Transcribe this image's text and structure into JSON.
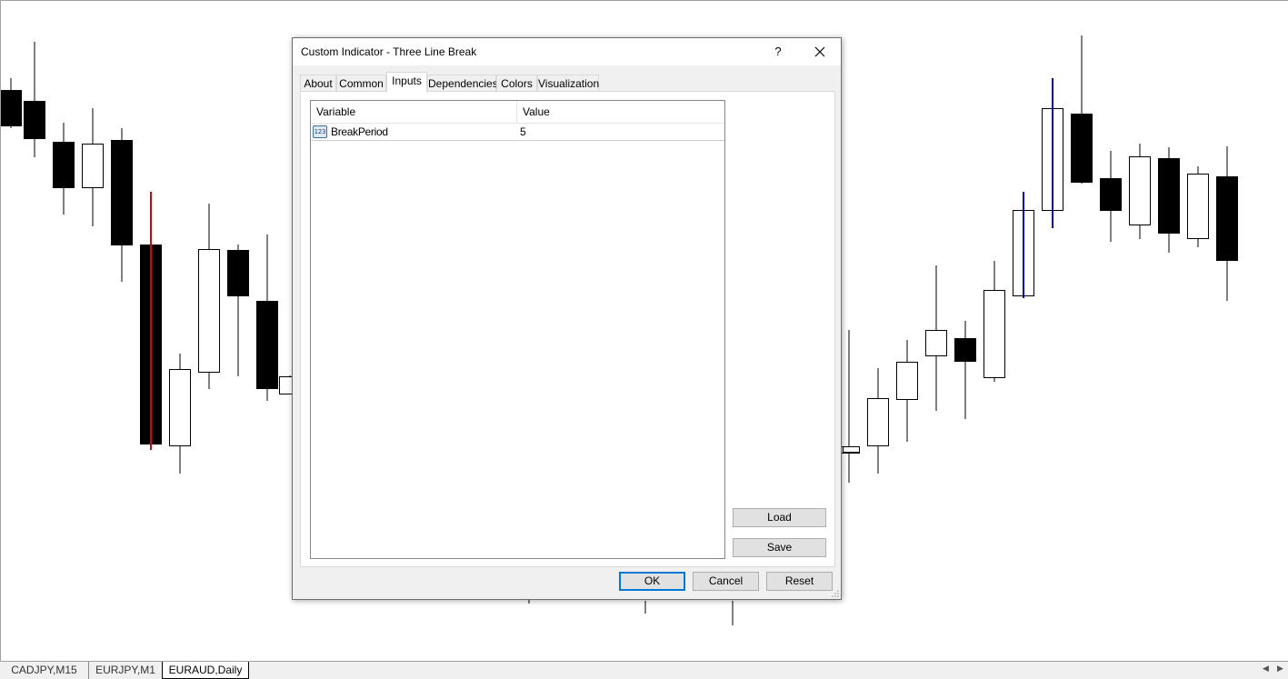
{
  "dialog": {
    "title": "Custom Indicator - Three Line Break",
    "help_label": "?",
    "tabs": [
      {
        "label": "About"
      },
      {
        "label": "Common"
      },
      {
        "label": "Inputs"
      },
      {
        "label": "Dependencies"
      },
      {
        "label": "Colors"
      },
      {
        "label": "Visualization"
      }
    ],
    "active_tab": "Inputs",
    "table": {
      "headers": {
        "variable": "Variable",
        "value": "Value"
      },
      "rows": [
        {
          "icon": "123",
          "variable": "BreakPeriod",
          "value": "5"
        }
      ]
    },
    "buttons": {
      "load": "Load",
      "save": "Save",
      "ok": "OK",
      "cancel": "Cancel",
      "reset": "Reset"
    }
  },
  "bottom_tabs": [
    {
      "label": "CADJPY,M15"
    },
    {
      "label": "EURJPY,M1"
    },
    {
      "label": "EURAUD,Daily"
    }
  ],
  "active_bottom_tab": "EURAUD,Daily",
  "colors": {
    "bull_body": "#ffffff",
    "bear_body": "#000000",
    "wick": "#000000",
    "red_line": "#e00000",
    "blue_line": "#0000cc",
    "accent": "#0078d7"
  }
}
